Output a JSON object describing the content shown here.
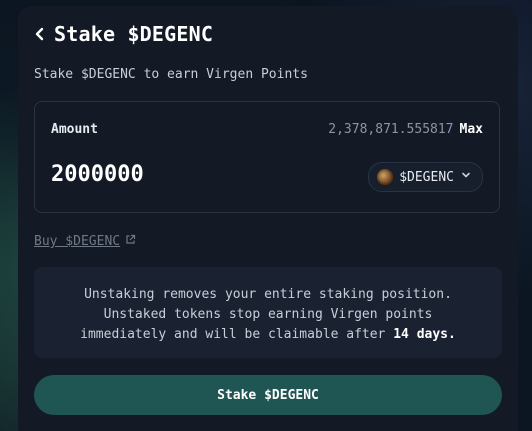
{
  "header": {
    "title": "Stake $DEGENC",
    "back_icon": "chevron-left-icon"
  },
  "subtitle": "Stake $DEGENC to earn Virgen Points",
  "amount": {
    "label": "Amount",
    "balance": "2,378,871.555817",
    "max_label": "Max",
    "value": "2000000",
    "token_label": "$DEGENC",
    "token_icon": "degenc-token-icon",
    "dropdown_icon": "chevron-down-icon"
  },
  "buy_link": {
    "label": "Buy $DEGENC",
    "icon": "external-link-icon"
  },
  "info": {
    "text": "Unstaking removes your entire staking position. Unstaked tokens stop earning Virgen points immediately and will be claimable after",
    "strong": "14 days."
  },
  "stake_button": {
    "label": "Stake $DEGENC",
    "color": "#1f5553"
  }
}
